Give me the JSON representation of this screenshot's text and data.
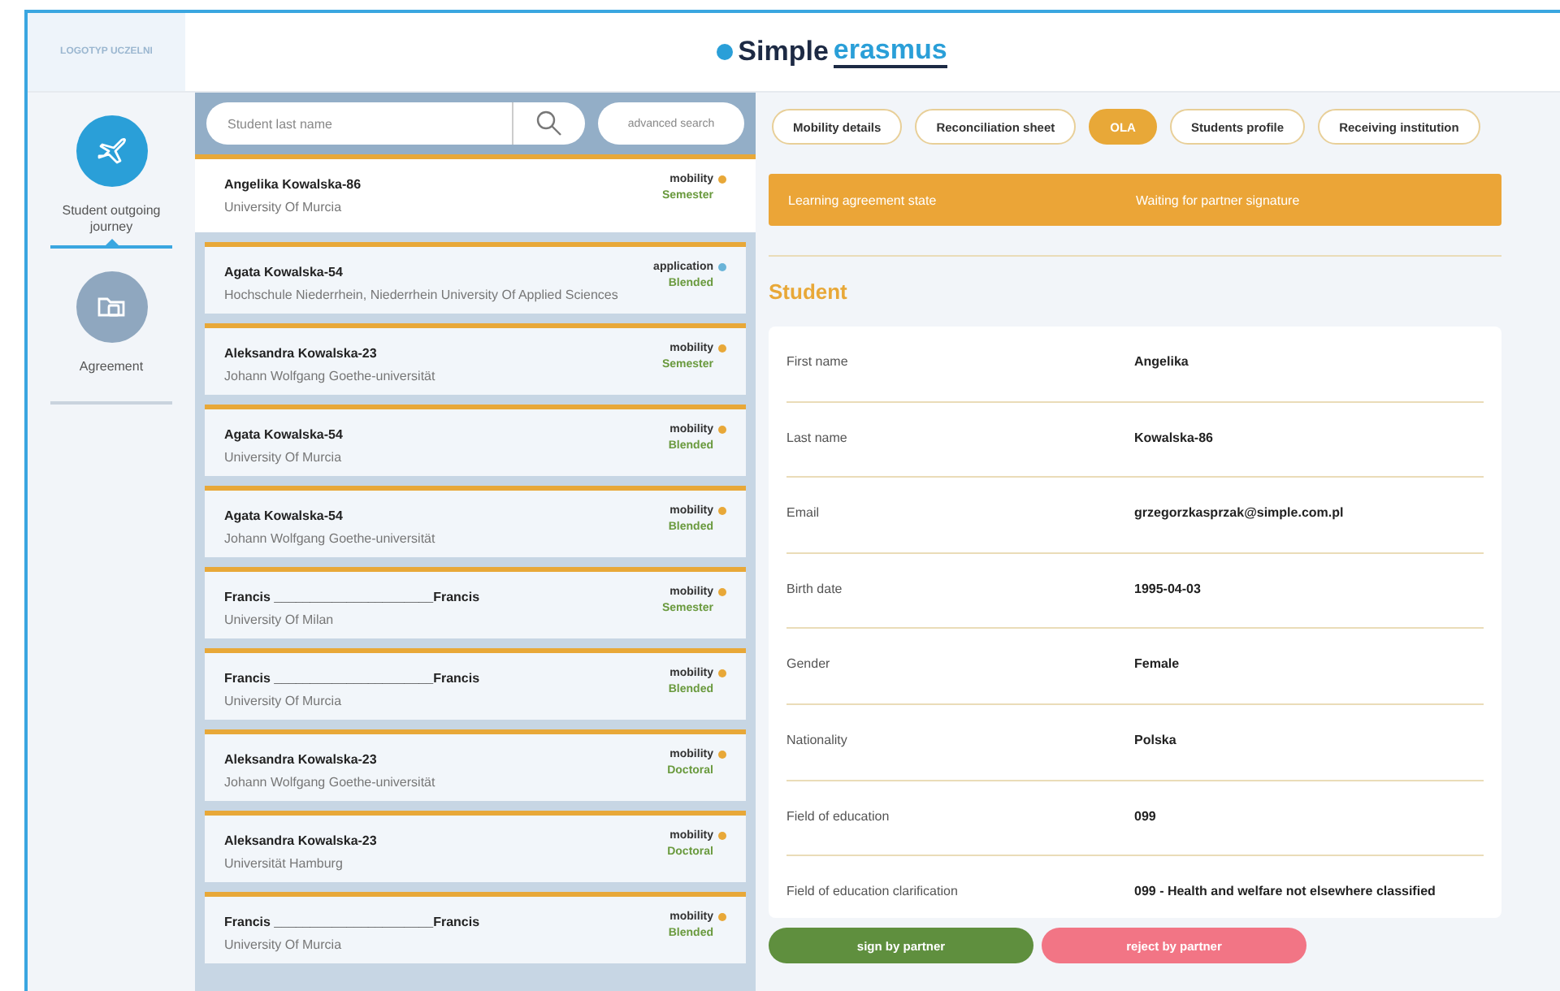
{
  "header": {
    "logo_placeholder": "LOGOTYP UCZELNI",
    "brand_part_1": "Simple",
    "brand_part_2": "erasmus"
  },
  "sidebar": {
    "items": [
      {
        "label": "Student outgoing journey",
        "selected": true,
        "kind": "plane"
      },
      {
        "label": "Agreement",
        "selected": false,
        "kind": "folder"
      }
    ]
  },
  "search": {
    "placeholder": "Student last name",
    "advanced_button": "advanced search"
  },
  "students": [
    {
      "name": "Angelika Kowalska-86",
      "university": "University Of Murcia",
      "status": "mobility",
      "color": "#e8a838",
      "type": "Semester",
      "selected": true
    },
    {
      "name": "Agata Kowalska-54",
      "university": "Hochschule Niederrhein, Niederrhein University Of Applied Sciences",
      "status": "application",
      "color": "#6ab4d8",
      "type": "Blended",
      "selected": false
    },
    {
      "name": "Aleksandra Kowalska-23",
      "university": "Johann Wolfgang Goethe-universität",
      "status": "mobility",
      "color": "#e8a838",
      "type": "Semester",
      "selected": false
    },
    {
      "name": "Agata Kowalska-54",
      "university": "University Of Murcia",
      "status": "mobility",
      "color": "#e8a838",
      "type": "Blended",
      "selected": false
    },
    {
      "name": "Agata Kowalska-54",
      "university": "Johann Wolfgang Goethe-universität",
      "status": "mobility",
      "color": "#e8a838",
      "type": "Blended",
      "selected": false
    },
    {
      "name": "Francis ______________________Francis",
      "university": "University Of Milan",
      "status": "mobility",
      "color": "#e8a838",
      "type": "Semester",
      "selected": false
    },
    {
      "name": "Francis ______________________Francis",
      "university": "University Of Murcia",
      "status": "mobility",
      "color": "#e8a838",
      "type": "Blended",
      "selected": false
    },
    {
      "name": "Aleksandra Kowalska-23",
      "university": "Johann Wolfgang Goethe-universität",
      "status": "mobility",
      "color": "#e8a838",
      "type": "Doctoral",
      "selected": false
    },
    {
      "name": "Aleksandra Kowalska-23",
      "university": "Universität Hamburg",
      "status": "mobility",
      "color": "#e8a838",
      "type": "Doctoral",
      "selected": false
    },
    {
      "name": "Francis ______________________Francis",
      "university": "University Of Murcia",
      "status": "mobility",
      "color": "#e8a838",
      "type": "Blended",
      "selected": false
    }
  ],
  "tabs": [
    {
      "label": "Mobility details",
      "selected": false
    },
    {
      "label": "Reconciliation sheet",
      "selected": false
    },
    {
      "label": "OLA",
      "selected": true
    },
    {
      "label": "Students profile",
      "selected": false
    },
    {
      "label": "Receiving institution",
      "selected": false
    }
  ],
  "state_banner": {
    "label": "Learning agreement state",
    "value": "Waiting for partner signature"
  },
  "section_title": "Student",
  "fields": [
    {
      "label": "First name",
      "value": "Angelika"
    },
    {
      "label": "Last name",
      "value": "Kowalska-86"
    },
    {
      "label": "Email",
      "value": "grzegorzkasprzak@simple.com.pl"
    },
    {
      "label": "Birth date",
      "value": "1995-04-03"
    },
    {
      "label": "Gender",
      "value": "Female"
    },
    {
      "label": "Nationality",
      "value": "Polska"
    },
    {
      "label": "Field of education",
      "value": "099"
    },
    {
      "label": "Field of education clarification",
      "value": "099 - Health and welfare not elsewhere classified"
    }
  ],
  "actions": [
    {
      "label": "sign by partner",
      "kind": "approve"
    },
    {
      "label": "reject by partner",
      "kind": "reject"
    }
  ]
}
